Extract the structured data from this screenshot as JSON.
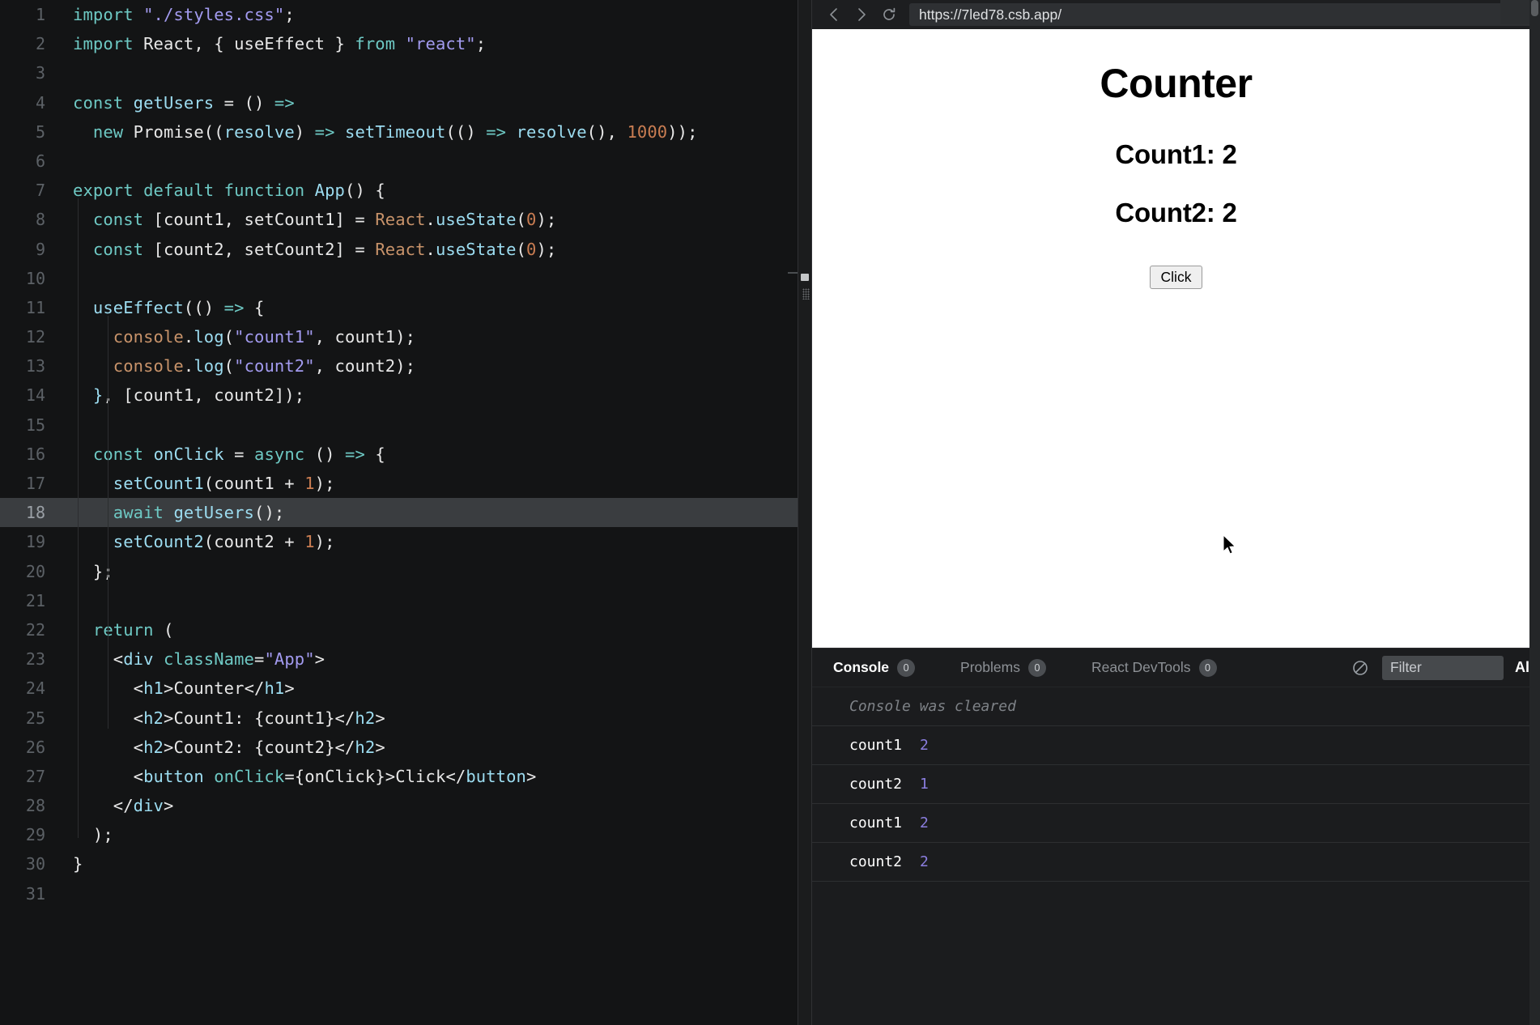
{
  "editor": {
    "highlighted_line": 18,
    "lines": [
      {
        "n": 1,
        "tokens": [
          {
            "t": "import",
            "c": "key"
          },
          {
            "t": " ",
            "c": "plain"
          },
          {
            "t": "\"./styles.css\"",
            "c": "str"
          },
          {
            "t": ";",
            "c": "punct"
          }
        ]
      },
      {
        "n": 2,
        "tokens": [
          {
            "t": "import",
            "c": "key"
          },
          {
            "t": " React",
            "c": "plain"
          },
          {
            "t": ", { ",
            "c": "punct"
          },
          {
            "t": "useEffect",
            "c": "plain"
          },
          {
            "t": " } ",
            "c": "punct"
          },
          {
            "t": "from",
            "c": "key"
          },
          {
            "t": " ",
            "c": "plain"
          },
          {
            "t": "\"react\"",
            "c": "str"
          },
          {
            "t": ";",
            "c": "punct"
          }
        ]
      },
      {
        "n": 3,
        "tokens": []
      },
      {
        "n": 4,
        "tokens": [
          {
            "t": "const",
            "c": "key"
          },
          {
            "t": " ",
            "c": "plain"
          },
          {
            "t": "getUsers",
            "c": "fn"
          },
          {
            "t": " ",
            "c": "plain"
          },
          {
            "t": "=",
            "c": "plain"
          },
          {
            "t": " () ",
            "c": "plain"
          },
          {
            "t": "=>",
            "c": "arrow"
          }
        ]
      },
      {
        "n": 5,
        "tokens": [
          {
            "t": "  ",
            "c": "plain"
          },
          {
            "t": "new",
            "c": "key"
          },
          {
            "t": " ",
            "c": "plain"
          },
          {
            "t": "Promise",
            "c": "plain"
          },
          {
            "t": "((",
            "c": "punct"
          },
          {
            "t": "resolve",
            "c": "fn"
          },
          {
            "t": ") ",
            "c": "punct"
          },
          {
            "t": "=>",
            "c": "arrow"
          },
          {
            "t": " ",
            "c": "plain"
          },
          {
            "t": "setTimeout",
            "c": "fn"
          },
          {
            "t": "(() ",
            "c": "punct"
          },
          {
            "t": "=>",
            "c": "arrow"
          },
          {
            "t": " ",
            "c": "plain"
          },
          {
            "t": "resolve",
            "c": "fn"
          },
          {
            "t": "(), ",
            "c": "punct"
          },
          {
            "t": "1000",
            "c": "num"
          },
          {
            "t": "));",
            "c": "punct"
          }
        ]
      },
      {
        "n": 6,
        "tokens": []
      },
      {
        "n": 7,
        "tokens": [
          {
            "t": "export",
            "c": "key"
          },
          {
            "t": " ",
            "c": "plain"
          },
          {
            "t": "default",
            "c": "key"
          },
          {
            "t": " ",
            "c": "plain"
          },
          {
            "t": "function",
            "c": "key"
          },
          {
            "t": " ",
            "c": "plain"
          },
          {
            "t": "App",
            "c": "fn"
          },
          {
            "t": "() {",
            "c": "punct"
          }
        ]
      },
      {
        "n": 8,
        "tokens": [
          {
            "t": "  ",
            "c": "plain"
          },
          {
            "t": "const",
            "c": "key"
          },
          {
            "t": " [count1, setCount1] ",
            "c": "plain"
          },
          {
            "t": "=",
            "c": "plain"
          },
          {
            "t": " ",
            "c": "plain"
          },
          {
            "t": "React",
            "c": "obj"
          },
          {
            "t": ".",
            "c": "plain"
          },
          {
            "t": "useState",
            "c": "fn"
          },
          {
            "t": "(",
            "c": "punct"
          },
          {
            "t": "0",
            "c": "num"
          },
          {
            "t": ");",
            "c": "punct"
          }
        ]
      },
      {
        "n": 9,
        "tokens": [
          {
            "t": "  ",
            "c": "plain"
          },
          {
            "t": "const",
            "c": "key"
          },
          {
            "t": " [count2, setCount2] ",
            "c": "plain"
          },
          {
            "t": "=",
            "c": "plain"
          },
          {
            "t": " ",
            "c": "plain"
          },
          {
            "t": "React",
            "c": "obj"
          },
          {
            "t": ".",
            "c": "plain"
          },
          {
            "t": "useState",
            "c": "fn"
          },
          {
            "t": "(",
            "c": "punct"
          },
          {
            "t": "0",
            "c": "num"
          },
          {
            "t": ");",
            "c": "punct"
          }
        ]
      },
      {
        "n": 10,
        "tokens": []
      },
      {
        "n": 11,
        "tokens": [
          {
            "t": "  ",
            "c": "plain"
          },
          {
            "t": "useEffect",
            "c": "fn"
          },
          {
            "t": "(() ",
            "c": "punct"
          },
          {
            "t": "=>",
            "c": "arrow"
          },
          {
            "t": " {",
            "c": "punct"
          }
        ]
      },
      {
        "n": 12,
        "tokens": [
          {
            "t": "    ",
            "c": "plain"
          },
          {
            "t": "console",
            "c": "obj"
          },
          {
            "t": ".",
            "c": "plain"
          },
          {
            "t": "log",
            "c": "fn"
          },
          {
            "t": "(",
            "c": "punct"
          },
          {
            "t": "\"count1\"",
            "c": "str"
          },
          {
            "t": ", count1);",
            "c": "plain"
          }
        ]
      },
      {
        "n": 13,
        "tokens": [
          {
            "t": "    ",
            "c": "plain"
          },
          {
            "t": "console",
            "c": "obj"
          },
          {
            "t": ".",
            "c": "plain"
          },
          {
            "t": "log",
            "c": "fn"
          },
          {
            "t": "(",
            "c": "punct"
          },
          {
            "t": "\"count2\"",
            "c": "str"
          },
          {
            "t": ", count2);",
            "c": "plain"
          }
        ]
      },
      {
        "n": 14,
        "tokens": [
          {
            "t": "  ",
            "c": "plain"
          },
          {
            "t": "}",
            "c": "fn"
          },
          {
            "t": ", [count1, count2]);",
            "c": "plain"
          }
        ]
      },
      {
        "n": 15,
        "tokens": []
      },
      {
        "n": 16,
        "tokens": [
          {
            "t": "  ",
            "c": "plain"
          },
          {
            "t": "const",
            "c": "key"
          },
          {
            "t": " ",
            "c": "plain"
          },
          {
            "t": "onClick",
            "c": "fn"
          },
          {
            "t": " ",
            "c": "plain"
          },
          {
            "t": "=",
            "c": "plain"
          },
          {
            "t": " ",
            "c": "plain"
          },
          {
            "t": "async",
            "c": "key"
          },
          {
            "t": " () ",
            "c": "plain"
          },
          {
            "t": "=>",
            "c": "arrow"
          },
          {
            "t": " {",
            "c": "punct"
          }
        ]
      },
      {
        "n": 17,
        "tokens": [
          {
            "t": "    ",
            "c": "plain"
          },
          {
            "t": "setCount1",
            "c": "fn"
          },
          {
            "t": "(count1 + ",
            "c": "plain"
          },
          {
            "t": "1",
            "c": "num"
          },
          {
            "t": ");",
            "c": "plain"
          }
        ]
      },
      {
        "n": 18,
        "tokens": [
          {
            "t": "    ",
            "c": "plain"
          },
          {
            "t": "await",
            "c": "key"
          },
          {
            "t": " ",
            "c": "plain"
          },
          {
            "t": "getUsers",
            "c": "fn"
          },
          {
            "t": "();",
            "c": "plain"
          }
        ]
      },
      {
        "n": 19,
        "tokens": [
          {
            "t": "    ",
            "c": "plain"
          },
          {
            "t": "setCount2",
            "c": "fn"
          },
          {
            "t": "(count2 + ",
            "c": "plain"
          },
          {
            "t": "1",
            "c": "num"
          },
          {
            "t": ");",
            "c": "plain"
          }
        ]
      },
      {
        "n": 20,
        "tokens": [
          {
            "t": "  };",
            "c": "plain"
          }
        ]
      },
      {
        "n": 21,
        "tokens": []
      },
      {
        "n": 22,
        "tokens": [
          {
            "t": "  ",
            "c": "plain"
          },
          {
            "t": "return",
            "c": "key"
          },
          {
            "t": " (",
            "c": "punct"
          }
        ]
      },
      {
        "n": 23,
        "tokens": [
          {
            "t": "    <",
            "c": "punct"
          },
          {
            "t": "div",
            "c": "tag"
          },
          {
            "t": " ",
            "c": "plain"
          },
          {
            "t": "className",
            "c": "attr"
          },
          {
            "t": "=",
            "c": "plain"
          },
          {
            "t": "\"App\"",
            "c": "str"
          },
          {
            "t": ">",
            "c": "punct"
          }
        ]
      },
      {
        "n": 24,
        "tokens": [
          {
            "t": "      <",
            "c": "punct"
          },
          {
            "t": "h1",
            "c": "tag"
          },
          {
            "t": ">",
            "c": "punct"
          },
          {
            "t": "Counter",
            "c": "plain"
          },
          {
            "t": "</",
            "c": "punct"
          },
          {
            "t": "h1",
            "c": "tag"
          },
          {
            "t": ">",
            "c": "punct"
          }
        ]
      },
      {
        "n": 25,
        "tokens": [
          {
            "t": "      <",
            "c": "punct"
          },
          {
            "t": "h2",
            "c": "tag"
          },
          {
            "t": ">",
            "c": "punct"
          },
          {
            "t": "Count1: {count1}",
            "c": "plain"
          },
          {
            "t": "</",
            "c": "punct"
          },
          {
            "t": "h2",
            "c": "tag"
          },
          {
            "t": ">",
            "c": "punct"
          }
        ]
      },
      {
        "n": 26,
        "tokens": [
          {
            "t": "      <",
            "c": "punct"
          },
          {
            "t": "h2",
            "c": "tag"
          },
          {
            "t": ">",
            "c": "punct"
          },
          {
            "t": "Count2: {count2}",
            "c": "plain"
          },
          {
            "t": "</",
            "c": "punct"
          },
          {
            "t": "h2",
            "c": "tag"
          },
          {
            "t": ">",
            "c": "punct"
          }
        ]
      },
      {
        "n": 27,
        "tokens": [
          {
            "t": "      <",
            "c": "punct"
          },
          {
            "t": "button",
            "c": "tag"
          },
          {
            "t": " ",
            "c": "plain"
          },
          {
            "t": "onClick",
            "c": "attr"
          },
          {
            "t": "=",
            "c": "plain"
          },
          {
            "t": "{onClick}",
            "c": "plain"
          },
          {
            "t": ">",
            "c": "punct"
          },
          {
            "t": "Click",
            "c": "plain"
          },
          {
            "t": "</",
            "c": "punct"
          },
          {
            "t": "button",
            "c": "tag"
          },
          {
            "t": ">",
            "c": "punct"
          }
        ]
      },
      {
        "n": 28,
        "tokens": [
          {
            "t": "    </",
            "c": "punct"
          },
          {
            "t": "div",
            "c": "tag"
          },
          {
            "t": ">",
            "c": "punct"
          }
        ]
      },
      {
        "n": 29,
        "tokens": [
          {
            "t": "  );",
            "c": "plain"
          }
        ]
      },
      {
        "n": 30,
        "tokens": [
          {
            "t": "}",
            "c": "plain"
          }
        ]
      },
      {
        "n": 31,
        "tokens": []
      }
    ]
  },
  "browser": {
    "back_label": "Back",
    "forward_label": "Forward",
    "reload_label": "Reload",
    "url": "https://7led78.csb.app/"
  },
  "preview": {
    "title": "Counter",
    "count1_label": "Count1: 2",
    "count2_label": "Count2: 2",
    "button_label": "Click"
  },
  "console": {
    "tabs": [
      {
        "label": "Console",
        "badge": "0",
        "active": true
      },
      {
        "label": "Problems",
        "badge": "0",
        "active": false
      },
      {
        "label": "React DevTools",
        "badge": "0",
        "active": false
      }
    ],
    "clear_label": "Clear console",
    "filter_placeholder": "Filter",
    "level_label": "All",
    "cleared_message": "Console was cleared",
    "entries": [
      {
        "label": "count1",
        "value": "2"
      },
      {
        "label": "count2",
        "value": "1"
      },
      {
        "label": "count1",
        "value": "2"
      },
      {
        "label": "count2",
        "value": "2"
      }
    ]
  },
  "colors": {
    "editor_bg": "#131415",
    "preview_bg": "#ffffff",
    "console_bg": "#1b1c1e",
    "accent_keyword": "#6ec9c4",
    "accent_string": "#a39bf0",
    "accent_number": "#c97d52",
    "log_value": "#8b7ee0"
  }
}
